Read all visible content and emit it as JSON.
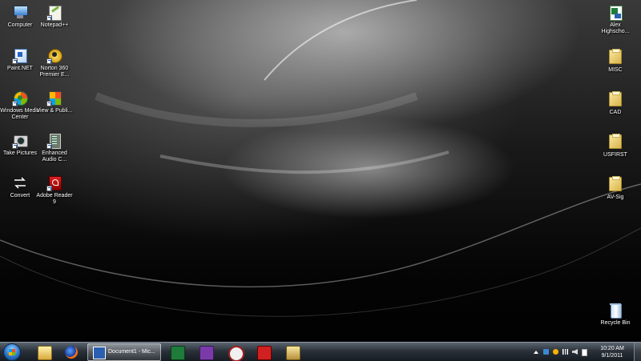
{
  "desktop": {
    "icons_left": [
      {
        "label": "Computer",
        "icon": "computer-icon"
      },
      {
        "label": "Notepad++",
        "icon": "notepadpp-icon"
      },
      {
        "label": "Paint.NET",
        "icon": "paintnet-icon"
      },
      {
        "label": "Norton 360 Premier E...",
        "icon": "norton-icon"
      },
      {
        "label": "Windows Media Center",
        "icon": "media-center-icon"
      },
      {
        "label": "View & Publi...",
        "icon": "view-publish-icon"
      },
      {
        "label": "Take Pictures",
        "icon": "camera-icon"
      },
      {
        "label": "Enhanced Audio C...",
        "icon": "audio-icon"
      },
      {
        "label": "Convert",
        "icon": "convert-icon"
      },
      {
        "label": "Adobe Reader 9",
        "icon": "adobe-reader-icon"
      }
    ],
    "icons_right": [
      {
        "label": "Alex Highscho...",
        "icon": "excel-file-icon"
      },
      {
        "label": "MISC",
        "icon": "folder-icon"
      },
      {
        "label": "CAD",
        "icon": "folder-icon"
      },
      {
        "label": "USFIRST",
        "icon": "folder-icon"
      },
      {
        "label": "AV-Sig",
        "icon": "folder-icon"
      },
      {
        "label": "Recycle Bin",
        "icon": "recycle-bin-icon"
      }
    ]
  },
  "taskbar": {
    "active_window_label": "Document1 - Mic...",
    "pinned": [
      "windows-explorer-icon",
      "firefox-icon",
      "excel-icon",
      "onenote-icon",
      "search-tool-icon",
      "solidworks-icon",
      "folder-tool-icon"
    ],
    "clock_time": "10:20 AM",
    "clock_date": "9/1/2011"
  },
  "colors": {
    "taskbar_top": "#5a6570",
    "taskbar_bottom": "#141a20",
    "accent_blue": "#2b74c8"
  }
}
